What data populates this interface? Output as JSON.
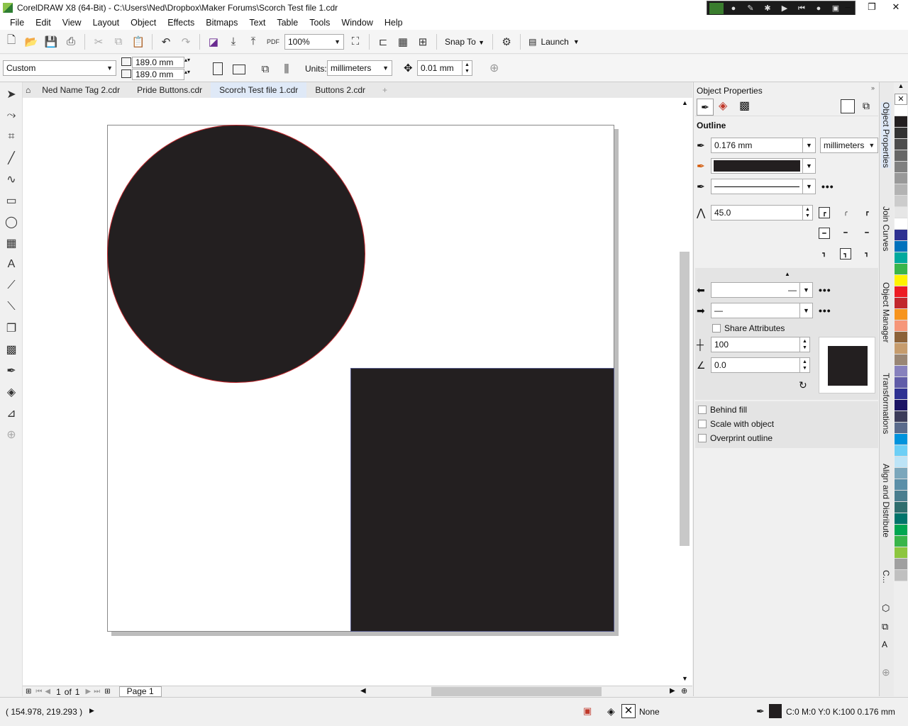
{
  "window": {
    "title": "CorelDRAW X8 (64-Bit) - C:\\Users\\Ned\\Dropbox\\Maker Forums\\Scorch Test file 1.cdr"
  },
  "menu": [
    "File",
    "Edit",
    "View",
    "Layout",
    "Object",
    "Effects",
    "Bitmaps",
    "Text",
    "Table",
    "Tools",
    "Window",
    "Help"
  ],
  "toolbar": {
    "zoom": "100%",
    "snap_to": "Snap To",
    "launch": "Launch"
  },
  "propbar": {
    "preset": "Custom",
    "width": "189.0 mm",
    "height": "189.0 mm",
    "units_label": "Units:",
    "units": "millimeters",
    "nudge": "0.01 mm"
  },
  "doc_tabs": [
    "Ned Name Tag 2.cdr",
    "Pride Buttons.cdr",
    "Scorch Test file 1.cdr",
    "Buttons 2.cdr"
  ],
  "active_tab": "Scorch Test file 1.cdr",
  "pagenav": {
    "current": "1",
    "of": "of",
    "total": "1",
    "page_tab": "Page 1"
  },
  "status": {
    "coords": "( 154.978, 219.293 )",
    "fill": "None",
    "outline": "C:0 M:0 Y:0 K:100  0.176 mm"
  },
  "docker": {
    "title": "Object Properties",
    "section": "Outline",
    "width": "0.176 mm",
    "width_units": "millimeters",
    "color": "#231f20",
    "miter": "45.0",
    "share_attributes": "Share Attributes",
    "stretch": "100",
    "angle": "0.0",
    "behind_fill": "Behind fill",
    "scale_with_object": "Scale with object",
    "overprint_outline": "Overprint outline"
  },
  "side_tabs": [
    "Object Properties",
    "Join Curves",
    "Object Manager",
    "Transformations",
    "Align and Distribute",
    "C..."
  ],
  "palette": [
    "#ffffff",
    "#231f20",
    "#333333",
    "#4d4d4d",
    "#666666",
    "#808080",
    "#999999",
    "#b3b3b3",
    "#cccccc",
    "#e6e6e6",
    "#ffffff",
    "#2e3192",
    "#0071bc",
    "#00a99d",
    "#39b54a",
    "#fff200",
    "#ed1c24",
    "#c1272d",
    "#f7941d",
    "#f69679",
    "#8c6239",
    "#c69c6d",
    "#998675",
    "#8781bd",
    "#605ca8",
    "#2e3192",
    "#1b1464",
    "#3c3c5a",
    "#5a6b8c",
    "#0093dd",
    "#6dcff6",
    "#bde4f7",
    "#7ba7bc",
    "#5b8fa8",
    "#4a7e8f",
    "#2f6e6e",
    "#00746b",
    "#00a651",
    "#39b54a",
    "#8dc63f",
    "#a0a0a0",
    "#c0c0c0"
  ],
  "shapes": {
    "circle_fill": "#231f20",
    "circle_outline": "#c0282d",
    "rect_fill": "#231f20",
    "rect_outline": "#555a8a"
  }
}
